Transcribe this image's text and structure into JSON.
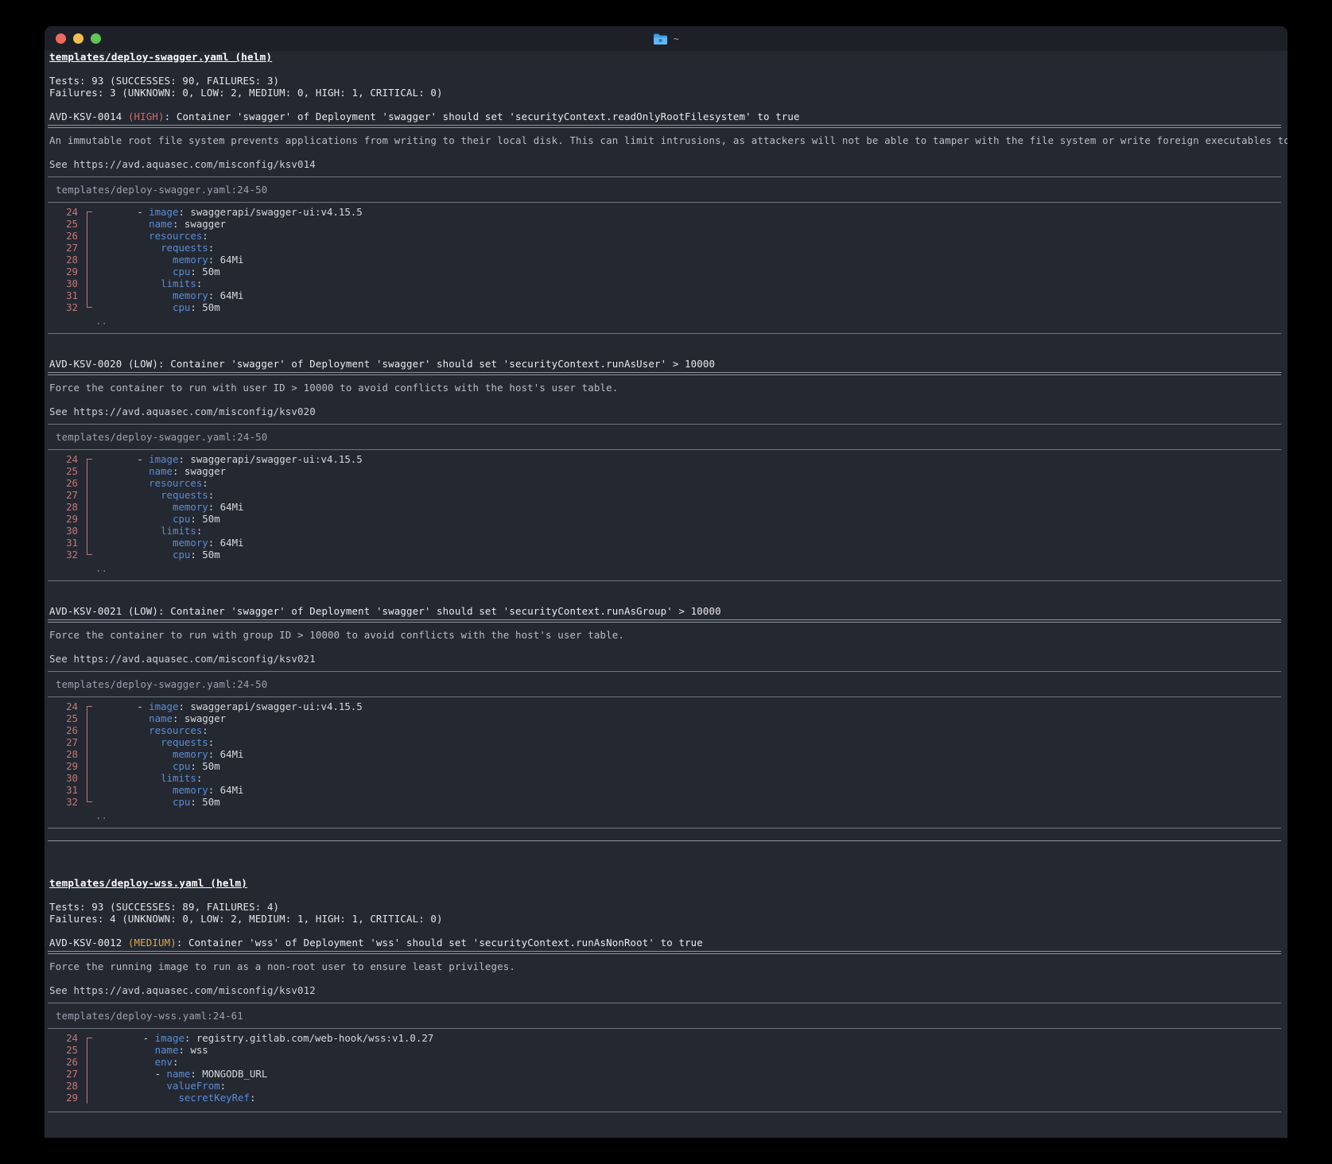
{
  "window": {
    "title": "~",
    "folder_icon": "folder-icon",
    "traffic_lights": [
      "close-red",
      "minimize-yellow",
      "maximize-green"
    ]
  },
  "sections": [
    {
      "file_heading": "templates/deploy-swagger.yaml (helm)",
      "tests_line": "Tests: 93 (SUCCESSES: 90, FAILURES: 3)",
      "failures_line": "Failures: 3 (UNKNOWN: 0, LOW: 2, MEDIUM: 0, HIGH: 1, CRITICAL: 0)",
      "findings": [
        {
          "id": "AVD-KSV-0014",
          "severity": "HIGH",
          "severity_color": "#d46a6a",
          "title_suffix": ": Container 'swagger' of Deployment 'swagger' should set 'securityContext.readOnlyRootFilesystem' to true",
          "description": "An immutable root file system prevents applications from writing to their local disk. This can limit intrusions, as attackers will not be able to tamper with the file system or write foreign executables to disk.",
          "see": "See https://avd.aquasec.com/misconfig/ksv014",
          "code_location": "templates/deploy-swagger.yaml:24-50",
          "code_lines": [
            {
              "no": "24",
              "bracket": "top",
              "text": "       - image: swaggerapi/swagger-ui:v4.15.5",
              "key": "image",
              "indent": 7,
              "dash": true,
              "value": " swaggerapi/swagger-ui:v4.15.5"
            },
            {
              "no": "25",
              "bracket": "mid",
              "key": "name",
              "indent": 9,
              "dash": false,
              "value": " swagger"
            },
            {
              "no": "26",
              "bracket": "mid",
              "key": "resources",
              "indent": 9,
              "dash": false,
              "value": ""
            },
            {
              "no": "27",
              "bracket": "mid",
              "key": "requests",
              "indent": 11,
              "dash": false,
              "value": ""
            },
            {
              "no": "28",
              "bracket": "mid",
              "key": "memory",
              "indent": 13,
              "dash": false,
              "value": " 64Mi"
            },
            {
              "no": "29",
              "bracket": "mid",
              "key": "cpu",
              "indent": 13,
              "dash": false,
              "value": " 50m"
            },
            {
              "no": "30",
              "bracket": "mid",
              "key": "limits",
              "indent": 11,
              "dash": false,
              "value": ""
            },
            {
              "no": "31",
              "bracket": "mid",
              "key": "memory",
              "indent": 13,
              "dash": false,
              "value": " 64Mi"
            },
            {
              "no": "32",
              "bracket": "bot",
              "key": "cpu",
              "indent": 13,
              "dash": false,
              "value": " 50m"
            }
          ],
          "continuation": ".."
        },
        {
          "id": "AVD-KSV-0020",
          "severity": "LOW",
          "severity_color": "#e8ebef",
          "title_suffix": ": Container 'swagger' of Deployment 'swagger' should set 'securityContext.runAsUser' > 10000",
          "description": "Force the container to run with user ID > 10000 to avoid conflicts with the host's user table.",
          "see": "See https://avd.aquasec.com/misconfig/ksv020",
          "code_location": "templates/deploy-swagger.yaml:24-50",
          "code_lines": [
            {
              "no": "24",
              "bracket": "top",
              "key": "image",
              "indent": 7,
              "dash": true,
              "value": " swaggerapi/swagger-ui:v4.15.5"
            },
            {
              "no": "25",
              "bracket": "mid",
              "key": "name",
              "indent": 9,
              "dash": false,
              "value": " swagger"
            },
            {
              "no": "26",
              "bracket": "mid",
              "key": "resources",
              "indent": 9,
              "dash": false,
              "value": ""
            },
            {
              "no": "27",
              "bracket": "mid",
              "key": "requests",
              "indent": 11,
              "dash": false,
              "value": ""
            },
            {
              "no": "28",
              "bracket": "mid",
              "key": "memory",
              "indent": 13,
              "dash": false,
              "value": " 64Mi"
            },
            {
              "no": "29",
              "bracket": "mid",
              "key": "cpu",
              "indent": 13,
              "dash": false,
              "value": " 50m"
            },
            {
              "no": "30",
              "bracket": "mid",
              "key": "limits",
              "indent": 11,
              "dash": false,
              "value": ""
            },
            {
              "no": "31",
              "bracket": "mid",
              "key": "memory",
              "indent": 13,
              "dash": false,
              "value": " 64Mi"
            },
            {
              "no": "32",
              "bracket": "bot",
              "key": "cpu",
              "indent": 13,
              "dash": false,
              "value": " 50m"
            }
          ],
          "continuation": ".."
        },
        {
          "id": "AVD-KSV-0021",
          "severity": "LOW",
          "severity_color": "#e8ebef",
          "title_suffix": ": Container 'swagger' of Deployment 'swagger' should set 'securityContext.runAsGroup' > 10000",
          "description": "Force the container to run with group ID > 10000 to avoid conflicts with the host's user table.",
          "see": "See https://avd.aquasec.com/misconfig/ksv021",
          "code_location": "templates/deploy-swagger.yaml:24-50",
          "code_lines": [
            {
              "no": "24",
              "bracket": "top",
              "key": "image",
              "indent": 7,
              "dash": true,
              "value": " swaggerapi/swagger-ui:v4.15.5"
            },
            {
              "no": "25",
              "bracket": "mid",
              "key": "name",
              "indent": 9,
              "dash": false,
              "value": " swagger"
            },
            {
              "no": "26",
              "bracket": "mid",
              "key": "resources",
              "indent": 9,
              "dash": false,
              "value": ""
            },
            {
              "no": "27",
              "bracket": "mid",
              "key": "requests",
              "indent": 11,
              "dash": false,
              "value": ""
            },
            {
              "no": "28",
              "bracket": "mid",
              "key": "memory",
              "indent": 13,
              "dash": false,
              "value": " 64Mi"
            },
            {
              "no": "29",
              "bracket": "mid",
              "key": "cpu",
              "indent": 13,
              "dash": false,
              "value": " 50m"
            },
            {
              "no": "30",
              "bracket": "mid",
              "key": "limits",
              "indent": 11,
              "dash": false,
              "value": ""
            },
            {
              "no": "31",
              "bracket": "mid",
              "key": "memory",
              "indent": 13,
              "dash": false,
              "value": " 64Mi"
            },
            {
              "no": "32",
              "bracket": "bot",
              "key": "cpu",
              "indent": 13,
              "dash": false,
              "value": " 50m"
            }
          ],
          "continuation": ".."
        }
      ]
    },
    {
      "file_heading": "templates/deploy-wss.yaml (helm)",
      "tests_line": "Tests: 93 (SUCCESSES: 89, FAILURES: 4)",
      "failures_line": "Failures: 4 (UNKNOWN: 0, LOW: 2, MEDIUM: 1, HIGH: 1, CRITICAL: 0)",
      "findings": [
        {
          "id": "AVD-KSV-0012",
          "severity": "MEDIUM",
          "severity_color": "#dfa846",
          "title_suffix": ": Container 'wss' of Deployment 'wss' should set 'securityContext.runAsNonRoot' to true",
          "description": "Force the running image to run as a non-root user to ensure least privileges.",
          "see": "See https://avd.aquasec.com/misconfig/ksv012",
          "code_location": "templates/deploy-wss.yaml:24-61",
          "code_lines": [
            {
              "no": "24",
              "bracket": "top",
              "key": "image",
              "indent": 8,
              "dash": true,
              "value": " registry.gitlab.com/web-hook/wss:v1.0.27"
            },
            {
              "no": "25",
              "bracket": "mid",
              "key": "name",
              "indent": 10,
              "dash": false,
              "value": " wss"
            },
            {
              "no": "26",
              "bracket": "mid",
              "key": "env",
              "indent": 10,
              "dash": false,
              "value": ""
            },
            {
              "no": "27",
              "bracket": "mid",
              "key": "name",
              "indent": 10,
              "dash": true,
              "value": " MONGODB_URL"
            },
            {
              "no": "28",
              "bracket": "mid",
              "key": "valueFrom",
              "indent": 12,
              "dash": false,
              "value": ""
            },
            {
              "no": "29",
              "bracket": "mid",
              "key": "secretKeyRef",
              "indent": 14,
              "dash": false,
              "value": ""
            }
          ],
          "continuation": ""
        }
      ]
    }
  ],
  "colors": {
    "background": "#242831",
    "titlebar": "#1d2027",
    "desktop": "#000000",
    "line_number": "#c27878",
    "yaml_key": "#5a8dd6",
    "text": "#d6d9de",
    "muted": "#9aa3b0",
    "rule": "#8e949e"
  }
}
